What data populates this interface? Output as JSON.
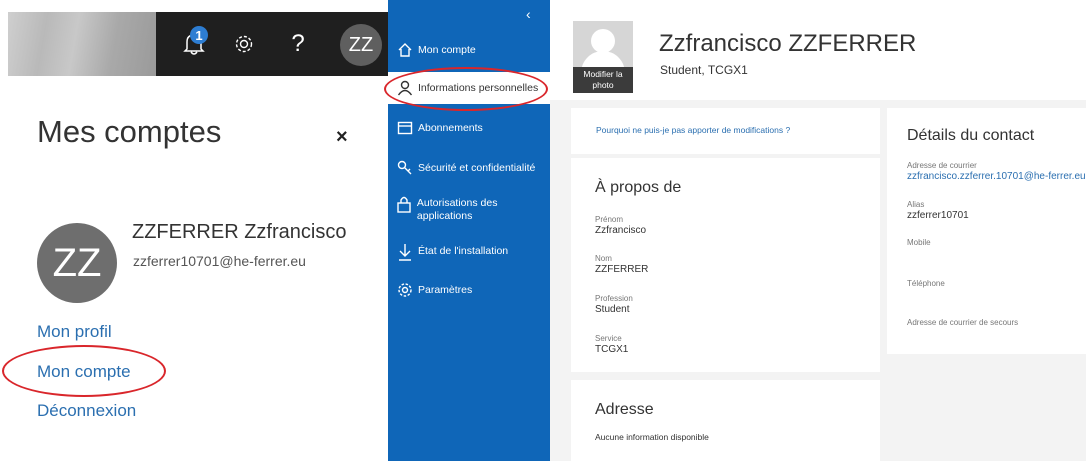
{
  "top_bar": {
    "notification_count": "1",
    "help_label": "?",
    "avatar_initials": "ZZ"
  },
  "accounts_panel": {
    "title": "Mes comptes",
    "close_label": "×",
    "avatar_initials": "ZZ",
    "user_name": "ZZFERRER Zzfrancisco",
    "user_email": "zzferrer10701@he-ferrer.eu",
    "links": [
      "Mon profil",
      "Mon compte",
      "Déconnexion"
    ]
  },
  "nav": {
    "collapse_label": "‹",
    "items": [
      {
        "label": "Mon compte",
        "icon": "home-icon"
      },
      {
        "label": "Informations personnelles",
        "icon": "person-icon"
      },
      {
        "label": "Abonnements",
        "icon": "card-icon"
      },
      {
        "label": "Sécurité et confidentialité",
        "icon": "key-icon"
      },
      {
        "label": "Autorisations des applications",
        "icon": "lock-icon"
      },
      {
        "label": "État de l'installation",
        "icon": "download-icon"
      },
      {
        "label": "Paramètres",
        "icon": "gear-icon"
      }
    ]
  },
  "profile": {
    "photo_caption": "Modifier la photo",
    "name": "Zzfrancisco ZZFERRER",
    "role": "Student, TCGX1",
    "why_link": "Pourquoi ne puis-je pas apporter de modifications ?",
    "about": {
      "title": "À propos de",
      "fields": [
        {
          "label": "Prénom",
          "value": "Zzfrancisco"
        },
        {
          "label": "Nom",
          "value": "ZZFERRER"
        },
        {
          "label": "Profession",
          "value": "Student"
        },
        {
          "label": "Service",
          "value": "TCGX1"
        }
      ]
    },
    "address": {
      "title": "Adresse",
      "text": "Aucune information disponible"
    },
    "contact": {
      "title": "Détails du contact",
      "fields": [
        {
          "label": "Adresse de courrier",
          "value": "zzfrancisco.zzferrer.10701@he-ferrer.eu"
        },
        {
          "label": "Alias",
          "value": "zzferrer10701"
        },
        {
          "label": "Mobile",
          "value": ""
        },
        {
          "label": "Téléphone",
          "value": ""
        },
        {
          "label": "Adresse de courrier de secours",
          "value": ""
        }
      ]
    }
  },
  "colors": {
    "nav_blue": "#0f66b8",
    "link_blue": "#2b6fb0",
    "annotation_red": "#d9262b",
    "badge_blue": "#2d7dd2"
  }
}
